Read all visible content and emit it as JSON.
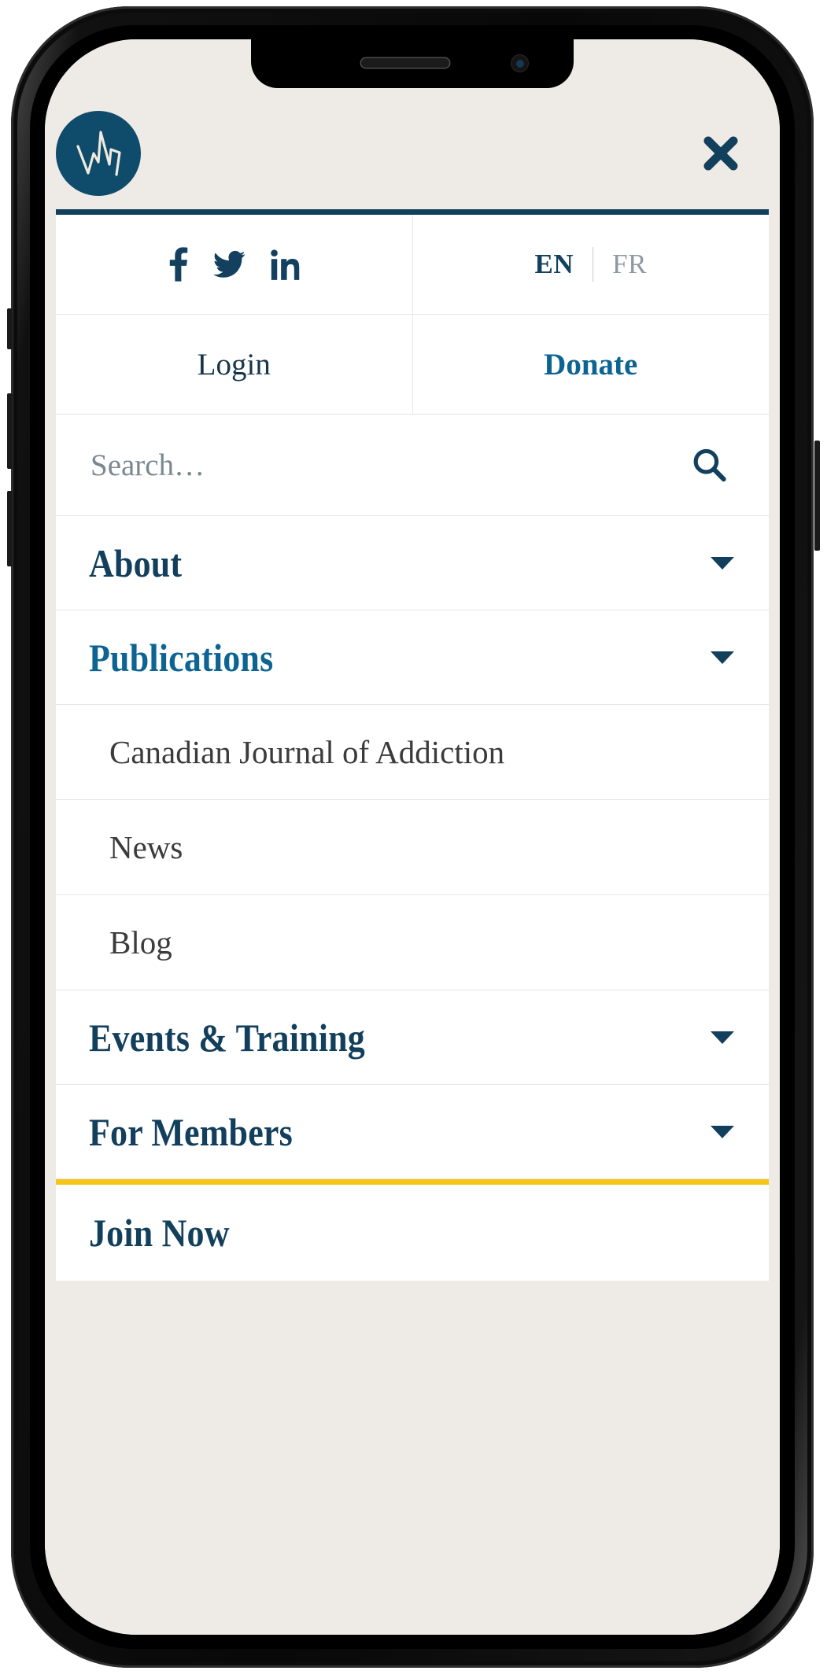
{
  "device": {
    "notch_speaker": "earpiece-speaker",
    "notch_camera": "front-camera"
  },
  "header": {
    "logo_alt": "CSAM logo",
    "close_label": "✕"
  },
  "colors": {
    "navy": "#123f5c",
    "teal": "#0d6492",
    "gold": "#f5c518",
    "panel_bg": "#ffffff",
    "screen_bg": "#eeeae5",
    "logo_circle": "#0f4c6b"
  },
  "utility_bar": {
    "social": [
      {
        "name": "facebook",
        "label": "f"
      },
      {
        "name": "twitter",
        "label": "twitter"
      },
      {
        "name": "linkedin",
        "label": "in"
      }
    ],
    "languages": [
      {
        "code": "EN",
        "active": true
      },
      {
        "code": "FR",
        "active": false
      }
    ],
    "separator": "|"
  },
  "actions": {
    "login": "Login",
    "donate": "Donate"
  },
  "search": {
    "placeholder": "Search…",
    "value": "",
    "icon": "search-icon"
  },
  "nav": [
    {
      "label": "About",
      "has_caret": true,
      "active": false
    },
    {
      "label": "Publications",
      "has_caret": true,
      "active": true
    },
    {
      "label": "Events & Training",
      "has_caret": true,
      "active": false
    },
    {
      "label": "For Members",
      "has_caret": true,
      "active": false
    }
  ],
  "submenu": {
    "parent": "Publications",
    "items": [
      {
        "label": "Canadian Journal of Addiction"
      },
      {
        "label": "News"
      },
      {
        "label": "Blog"
      }
    ]
  },
  "cta": {
    "label": "Join Now"
  }
}
